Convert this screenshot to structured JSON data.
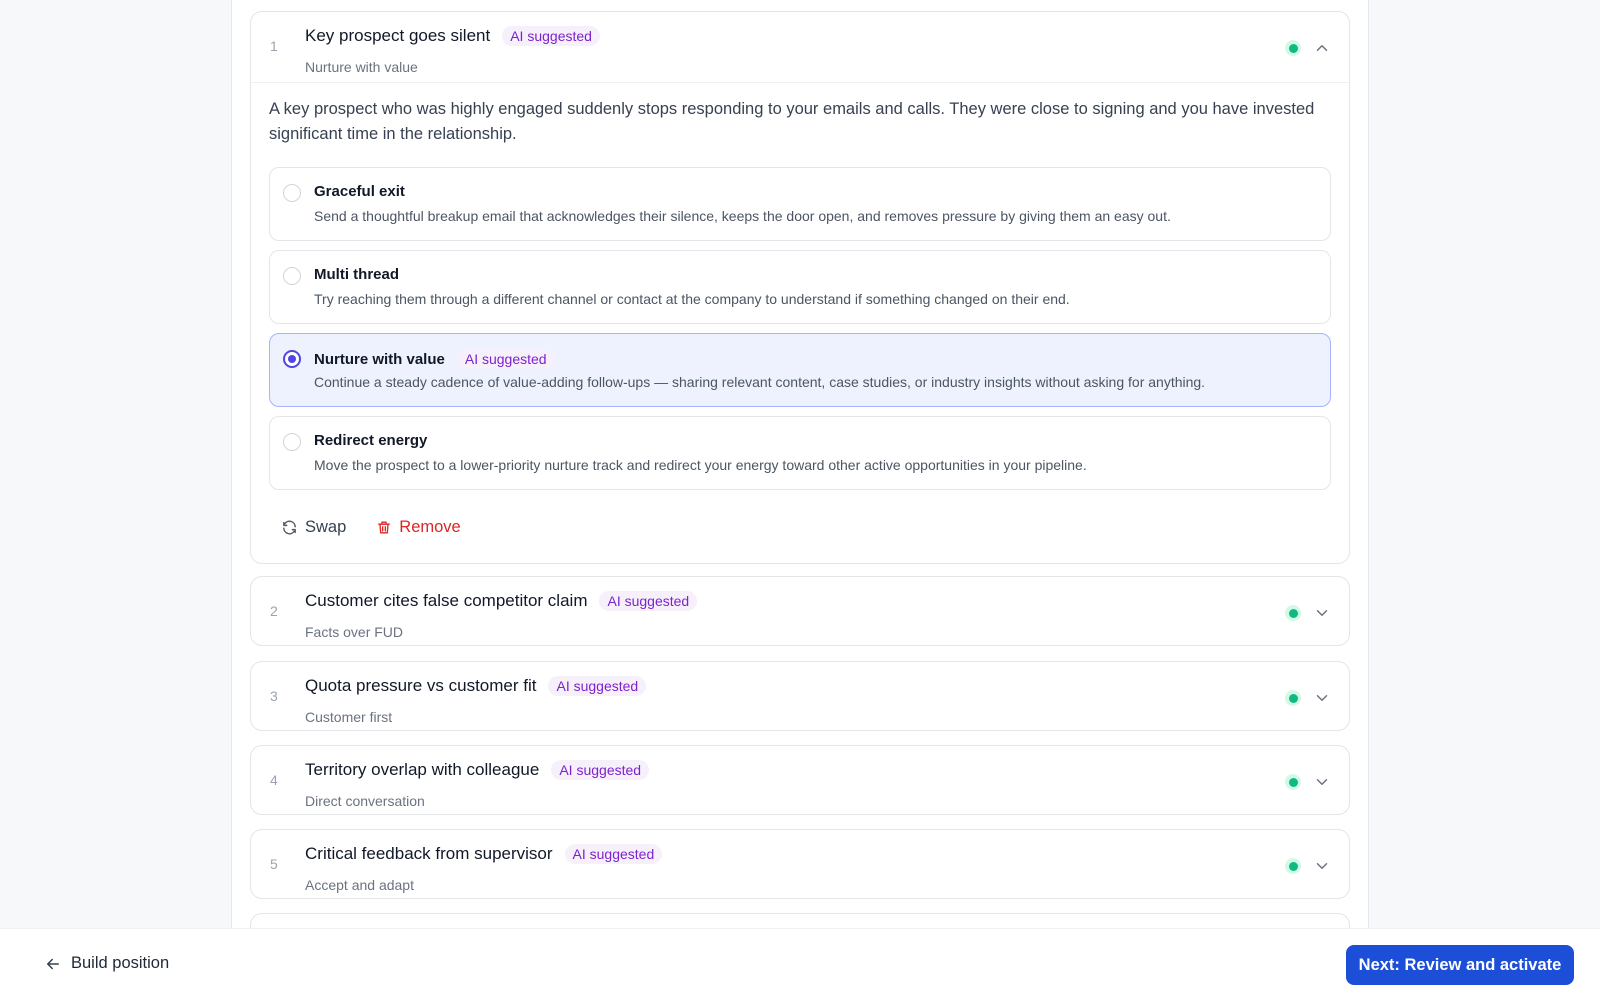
{
  "scenarios": [
    {
      "num": "1",
      "title": "Key prospect goes silent",
      "badge": "AI suggested",
      "subtitle": "Nurture with value",
      "description": "A key prospect who was highly engaged suddenly stops responding to your emails and calls. They were close to signing and you have invested significant time in the relationship.",
      "options": [
        {
          "title": "Graceful exit",
          "desc": "Send a thoughtful breakup email that acknowledges their silence, keeps the door open, and removes pressure by giving them an easy out.",
          "badge": ""
        },
        {
          "title": "Multi thread",
          "desc": "Try reaching them through a different channel or contact at the company to understand if something changed on their end.",
          "badge": ""
        },
        {
          "title": "Nurture with value",
          "desc": "Continue a steady cadence of value-adding follow-ups — sharing relevant content, case studies, or industry insights without asking for anything.",
          "badge": "AI suggested"
        },
        {
          "title": "Redirect energy",
          "desc": "Move the prospect to a lower-priority nurture track and redirect your energy toward other active opportunities in your pipeline.",
          "badge": ""
        }
      ],
      "selected_option": "Nurture with value"
    },
    {
      "num": "2",
      "title": "Customer cites false competitor claim",
      "badge": "AI suggested",
      "subtitle": "Facts over FUD"
    },
    {
      "num": "3",
      "title": "Quota pressure vs customer fit",
      "badge": "AI suggested",
      "subtitle": "Customer first"
    },
    {
      "num": "4",
      "title": "Territory overlap with colleague",
      "badge": "AI suggested",
      "subtitle": "Direct conversation"
    },
    {
      "num": "5",
      "title": "Critical feedback from supervisor",
      "badge": "AI suggested",
      "subtitle": "Accept and adapt"
    }
  ],
  "actions": {
    "swap": "Swap",
    "remove": "Remove"
  },
  "footer": {
    "back_label": "Build position",
    "next_label": "Next: Review and activate"
  },
  "colors": {
    "accent": "#1d4ed8",
    "badge_text": "#7e22ce",
    "status_green": "#10b981",
    "remove_red": "#dc2626"
  }
}
